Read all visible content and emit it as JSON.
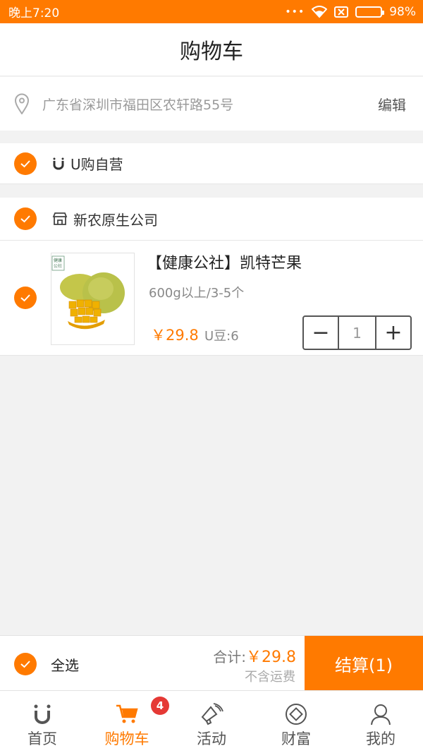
{
  "status": {
    "time": "晚上7:20",
    "dots": "•••",
    "battery": "98%",
    "battery_level": 0.98
  },
  "header": {
    "title": "购物车"
  },
  "address": {
    "text": "广东省深圳市福田区农轩路55号",
    "edit": "编辑"
  },
  "groups": [
    {
      "name": "U购自营",
      "icon": "u-brand-icon",
      "checked": true
    },
    {
      "name": "新农原生公司",
      "icon": "store-icon",
      "checked": true
    }
  ],
  "item": {
    "title": "【健康公社】凯特芒果",
    "spec": "600g以上/3-5个",
    "price": "￥29.8",
    "bean": "U豆:6",
    "quantity": "1",
    "minus": "−",
    "plus": "+",
    "image_stamp": [
      "健康",
      "公社"
    ],
    "checked": true
  },
  "footer": {
    "select_all": "全选",
    "total_label": "合计:",
    "total_amount": "￥29.8",
    "shipping_note": "不含运费",
    "checkout": "结算(1)"
  },
  "tabs": [
    {
      "label": "首页",
      "icon": "u-home-icon"
    },
    {
      "label": "购物车",
      "icon": "cart-icon",
      "badge": "4"
    },
    {
      "label": "活动",
      "icon": "megaphone-icon"
    },
    {
      "label": "财富",
      "icon": "coin-icon"
    },
    {
      "label": "我的",
      "icon": "profile-icon"
    }
  ],
  "colors": {
    "accent": "#ff7a00",
    "badge": "#e53935",
    "background": "#f2f2f2"
  }
}
